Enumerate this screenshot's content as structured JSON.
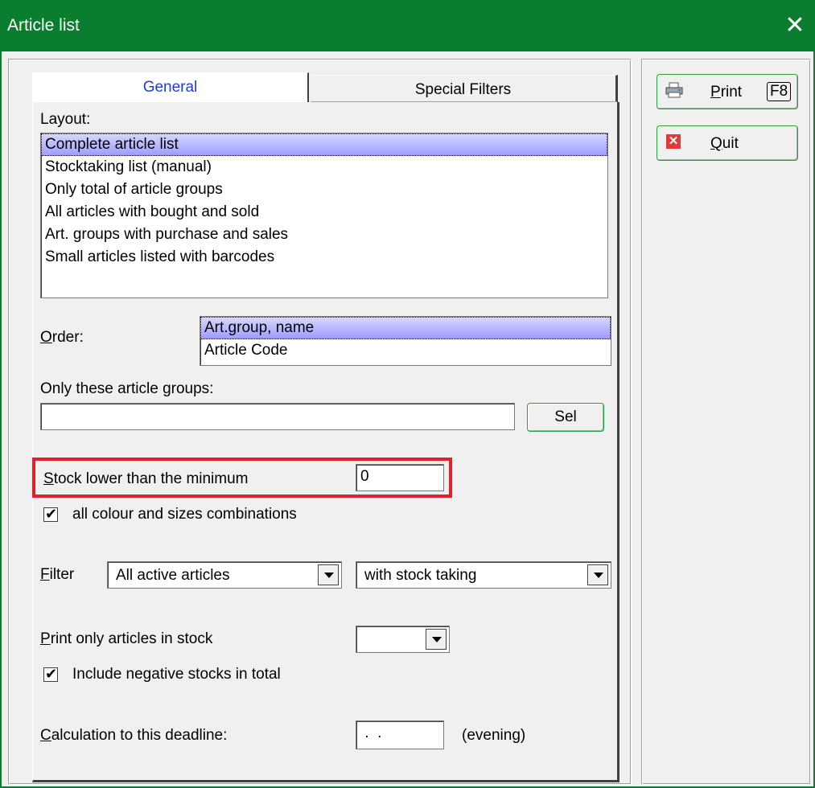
{
  "window": {
    "title": "Article list",
    "close_glyph": "✕"
  },
  "tabs": [
    {
      "label": "General",
      "active": true
    },
    {
      "label": "Special Filters",
      "active": false
    }
  ],
  "layout": {
    "label": "Layout:",
    "items": [
      "Complete article list",
      "Stocktaking list (manual)",
      "Only total of article groups",
      "All articles with bought and sold",
      "Art. groups with purchase and sales",
      "Small articles listed with barcodes"
    ],
    "selected_index": 0
  },
  "order": {
    "label_prefix": "",
    "label_mnemonic": "O",
    "label_rest": "rder:",
    "items": [
      "Art.group, name",
      "Article Code"
    ],
    "selected_index": 0
  },
  "article_groups": {
    "label": "Only these article groups:",
    "value": "",
    "sel_button": "Sel"
  },
  "stock_minimum": {
    "label_mnemonic": "S",
    "label_rest": "tock lower than the minimum",
    "value": "0"
  },
  "combinations_checkbox": {
    "label": "all colour and sizes combinations",
    "checked": true
  },
  "filter": {
    "label_mnemonic": "F",
    "label_rest": "ilter",
    "combo1": "All active articles",
    "combo2": "with stock taking"
  },
  "print_only_stock": {
    "label_mnemonic": "P",
    "label_rest": "rint only articles in stock",
    "value": ""
  },
  "negative_checkbox": {
    "label": "Include negative stocks in total",
    "checked": true
  },
  "deadline": {
    "label_mnemonic": "C",
    "label_rest": "alculation to this deadline:",
    "value": " .  .",
    "suffix": "(evening)"
  },
  "buttons": {
    "print_mnemonic": "P",
    "print_rest": "rint",
    "print_key": "F8",
    "quit_mnemonic": "Q",
    "quit_rest": "uit"
  },
  "colors": {
    "titlebar": "#0a7d2e",
    "highlight": "#e0202a",
    "tab_active_text": "#1f3ecf"
  },
  "icons": {
    "print": "printer-icon",
    "quit": "quit-x-icon",
    "close": "close-icon"
  }
}
